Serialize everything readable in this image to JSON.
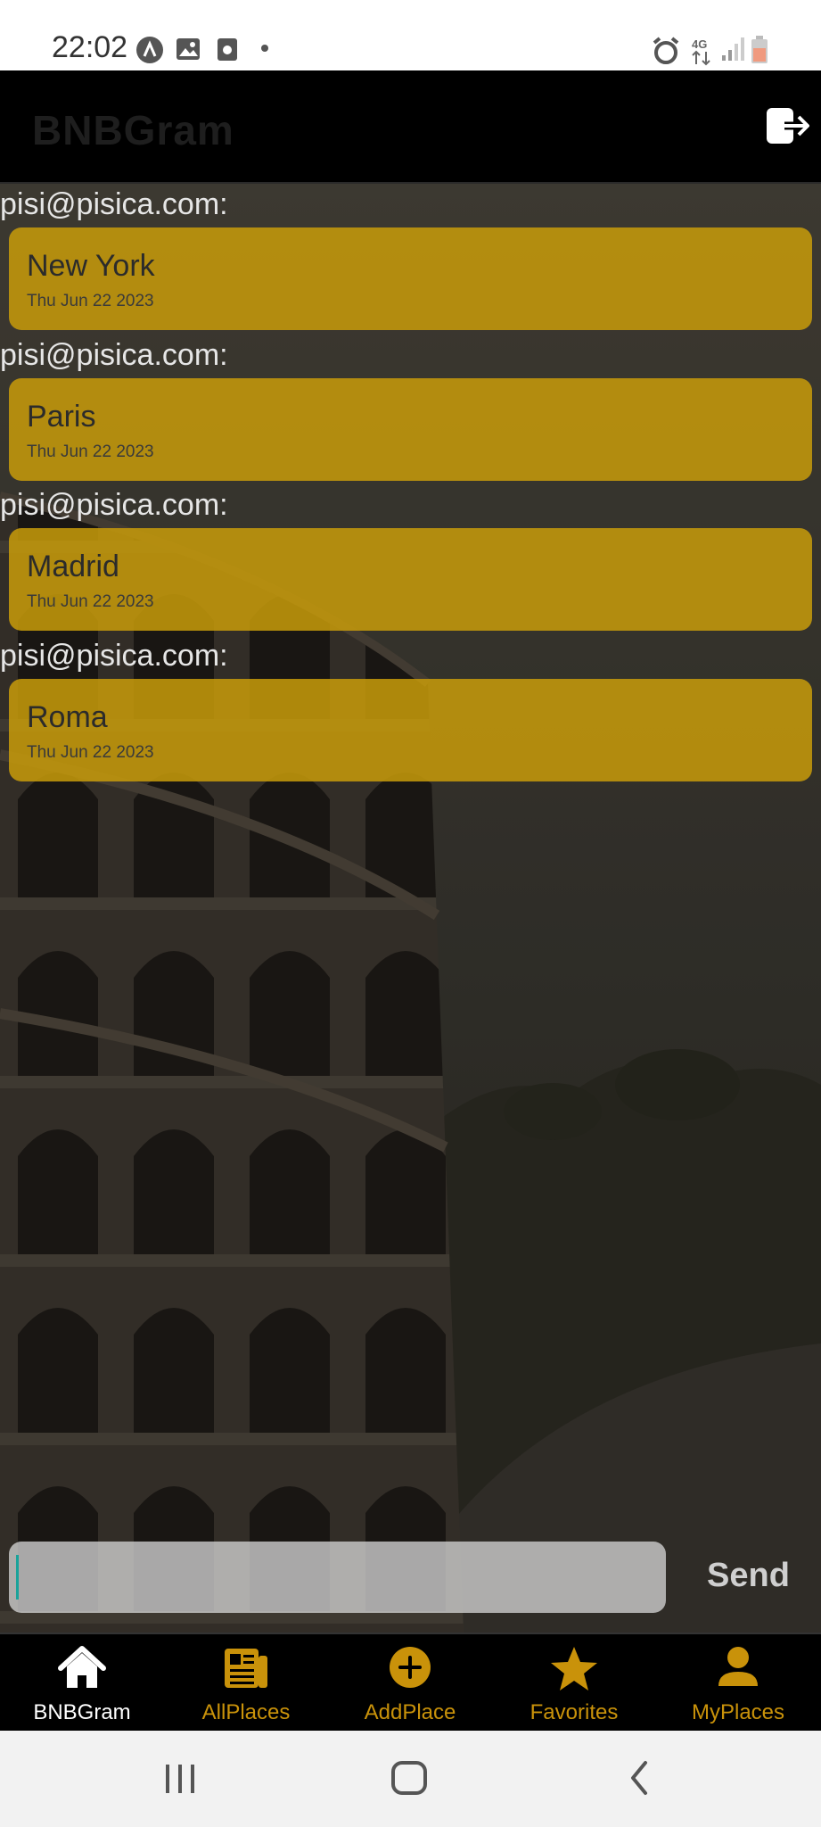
{
  "status_bar": {
    "time": "22:02",
    "icons": [
      "auto-sync-icon",
      "image-icon",
      "screen-record-icon",
      "alarm-icon",
      "4g-icon",
      "signal-icon",
      "battery-icon"
    ]
  },
  "header": {
    "title": "BNBGram",
    "logout_icon": "logout-icon"
  },
  "posts": [
    {
      "author": "pisi@pisica.com:",
      "place": "New York",
      "date": "Thu Jun 22 2023"
    },
    {
      "author": "pisi@pisica.com:",
      "place": "Paris",
      "date": "Thu Jun 22 2023"
    },
    {
      "author": "pisi@pisica.com:",
      "place": "Madrid",
      "date": "Thu Jun 22 2023"
    },
    {
      "author": "pisi@pisica.com:",
      "place": "Roma",
      "date": "Thu Jun 22 2023"
    }
  ],
  "composer": {
    "value": "",
    "send_label": "Send"
  },
  "tabs": [
    {
      "label": "BNBGram",
      "icon": "home-icon",
      "active": true
    },
    {
      "label": "AllPlaces",
      "icon": "newspaper-icon",
      "active": false
    },
    {
      "label": "AddPlace",
      "icon": "add-circle-icon",
      "active": false
    },
    {
      "label": "Favorites",
      "icon": "star-icon",
      "active": false
    },
    {
      "label": "MyPlaces",
      "icon": "person-icon",
      "active": false
    }
  ],
  "colors": {
    "accent": "#c9920a",
    "card": "#c79b0a",
    "header_bg": "#000000"
  }
}
